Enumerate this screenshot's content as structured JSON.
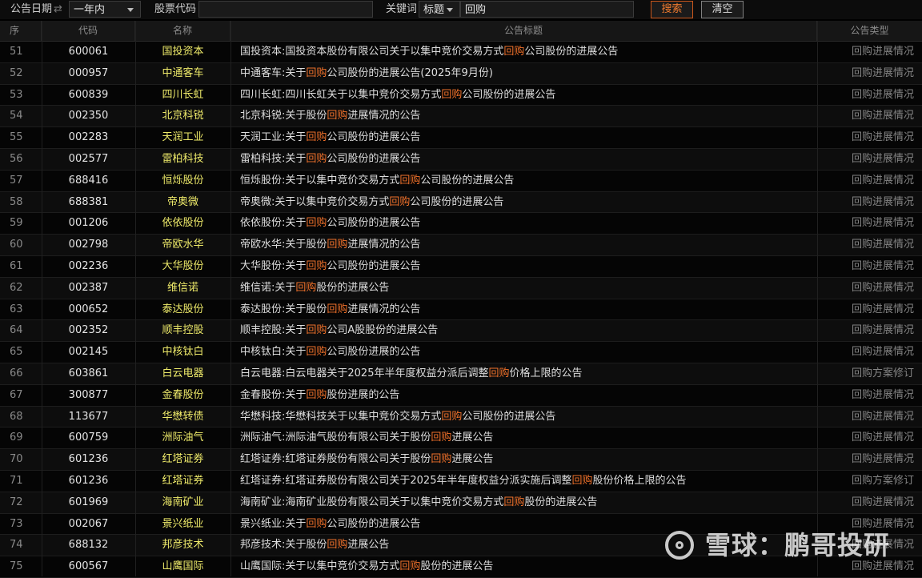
{
  "toolbar": {
    "date_label": "公告日期",
    "date_range_value": "一年内",
    "code_label": "股票代码",
    "code_value": "",
    "keyword_label": "关键词",
    "keyword_scope_value": "标题",
    "keyword_value": "回购",
    "search_label": "搜索",
    "clear_label": "清空"
  },
  "table": {
    "headers": {
      "idx": "序",
      "code": "代码",
      "name": "名称",
      "title": "公告标题",
      "type": "公告类型"
    },
    "highlight": "回购",
    "rows": [
      {
        "idx": "51",
        "code": "600061",
        "name": "国投资本",
        "title": "国投资本:国投资本股份有限公司关于以集中竞价交易方式回购公司股份的进展公告",
        "type": "回购进展情况"
      },
      {
        "idx": "52",
        "code": "000957",
        "name": "中通客车",
        "title": "中通客车:关于回购公司股份的进展公告(2025年9月份)",
        "type": "回购进展情况"
      },
      {
        "idx": "53",
        "code": "600839",
        "name": "四川长虹",
        "title": "四川长虹:四川长虹关于以集中竞价交易方式回购公司股份的进展公告",
        "type": "回购进展情况"
      },
      {
        "idx": "54",
        "code": "002350",
        "name": "北京科锐",
        "title": "北京科锐:关于股份回购进展情况的公告",
        "type": "回购进展情况"
      },
      {
        "idx": "55",
        "code": "002283",
        "name": "天润工业",
        "title": "天润工业:关于回购公司股份的进展公告",
        "type": "回购进展情况"
      },
      {
        "idx": "56",
        "code": "002577",
        "name": "雷柏科技",
        "title": "雷柏科技:关于回购公司股份的进展公告",
        "type": "回购进展情况"
      },
      {
        "idx": "57",
        "code": "688416",
        "name": "恒烁股份",
        "title": "恒烁股份:关于以集中竞价交易方式回购公司股份的进展公告",
        "type": "回购进展情况"
      },
      {
        "idx": "58",
        "code": "688381",
        "name": "帝奥微",
        "title": "帝奥微:关于以集中竞价交易方式回购公司股份的进展公告",
        "type": "回购进展情况"
      },
      {
        "idx": "59",
        "code": "001206",
        "name": "依依股份",
        "title": "依依股份:关于回购公司股份的进展公告",
        "type": "回购进展情况"
      },
      {
        "idx": "60",
        "code": "002798",
        "name": "帝欧水华",
        "title": "帝欧水华:关于股份回购进展情况的公告",
        "type": "回购进展情况"
      },
      {
        "idx": "61",
        "code": "002236",
        "name": "大华股份",
        "title": "大华股份:关于回购公司股份的进展公告",
        "type": "回购进展情况"
      },
      {
        "idx": "62",
        "code": "002387",
        "name": "维信诺",
        "title": "维信诺:关于回购股份的进展公告",
        "type": "回购进展情况"
      },
      {
        "idx": "63",
        "code": "000652",
        "name": "泰达股份",
        "title": "泰达股份:关于股份回购进展情况的公告",
        "type": "回购进展情况"
      },
      {
        "idx": "64",
        "code": "002352",
        "name": "顺丰控股",
        "title": "顺丰控股:关于回购公司A股股份的进展公告",
        "type": "回购进展情况"
      },
      {
        "idx": "65",
        "code": "002145",
        "name": "中核钛白",
        "title": "中核钛白:关于回购公司股份进展的公告",
        "type": "回购进展情况"
      },
      {
        "idx": "66",
        "code": "603861",
        "name": "白云电器",
        "title": "白云电器:白云电器关于2025年半年度权益分派后调整回购价格上限的公告",
        "type": "回购方案修订"
      },
      {
        "idx": "67",
        "code": "300877",
        "name": "金春股份",
        "title": "金春股份:关于回购股份进展的公告",
        "type": "回购进展情况"
      },
      {
        "idx": "68",
        "code": "113677",
        "name": "华懋转债",
        "title": "华懋科技:华懋科技关于以集中竞价交易方式回购公司股份的进展公告",
        "type": "回购进展情况"
      },
      {
        "idx": "69",
        "code": "600759",
        "name": "洲际油气",
        "title": "洲际油气:洲际油气股份有限公司关于股份回购进展公告",
        "type": "回购进展情况"
      },
      {
        "idx": "70",
        "code": "601236",
        "name": "红塔证券",
        "title": "红塔证券:红塔证券股份有限公司关于股份回购进展公告",
        "type": "回购进展情况"
      },
      {
        "idx": "71",
        "code": "601236",
        "name": "红塔证券",
        "title": "红塔证券:红塔证券股份有限公司关于2025年半年度权益分派实施后调整回购股份价格上限的公告",
        "type": "回购方案修订"
      },
      {
        "idx": "72",
        "code": "601969",
        "name": "海南矿业",
        "title": "海南矿业:海南矿业股份有限公司关于以集中竞价交易方式回购股份的进展公告",
        "type": "回购进展情况"
      },
      {
        "idx": "73",
        "code": "002067",
        "name": "景兴纸业",
        "title": "景兴纸业:关于回购公司股份的进展公告",
        "type": "回购进展情况"
      },
      {
        "idx": "74",
        "code": "688132",
        "name": "邦彦技术",
        "title": "邦彦技术:关于股份回购进展公告",
        "type": "回购进展情况"
      },
      {
        "idx": "75",
        "code": "600567",
        "name": "山鹰国际",
        "title": "山鹰国际:关于以集中竞价交易方式回购股份的进展公告",
        "type": "回购进展情况"
      }
    ]
  },
  "watermark": {
    "text": "雪球：鹏哥投研",
    "icon": "xueqiu-logo-icon"
  },
  "colors": {
    "highlight": "#f0712a",
    "stock_name": "#eeea6a",
    "search_button": "#c8561b"
  }
}
